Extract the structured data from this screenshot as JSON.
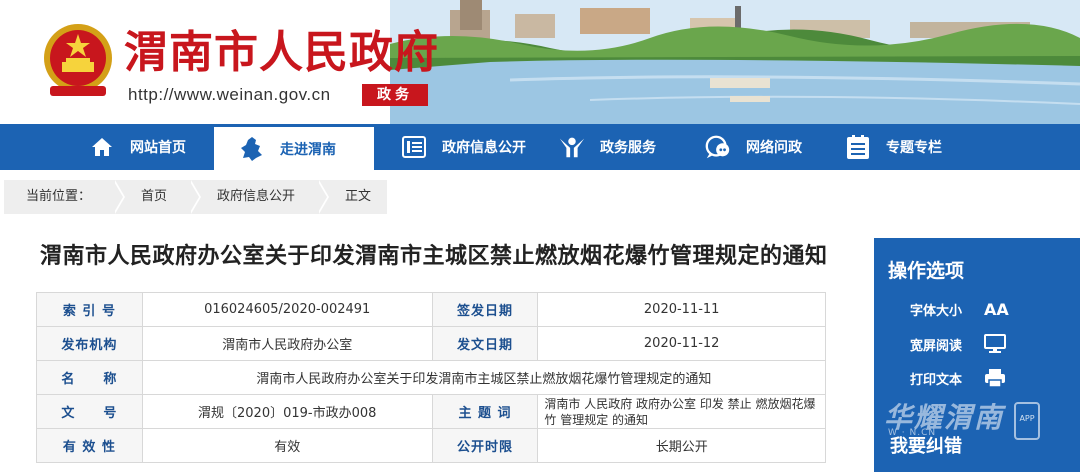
{
  "header": {
    "site_title": "渭南市人民政府",
    "site_url": "http://www.weinan.gov.cn",
    "badge": "政务",
    "emblem_icon": "national-emblem-icon",
    "colors": {
      "brand_red": "#c8161d",
      "nav_blue": "#1c63b3"
    }
  },
  "nav": {
    "items": [
      {
        "label": "网站首页",
        "icon": "home-icon"
      },
      {
        "label": "走进渭南",
        "icon": "region-map-icon"
      },
      {
        "label": "政府信息公开",
        "icon": "document-icon"
      },
      {
        "label": "政务服务",
        "icon": "service-person-icon"
      },
      {
        "label": "网络问政",
        "icon": "chat-bubble-icon"
      },
      {
        "label": "专题专栏",
        "icon": "list-clipboard-icon"
      }
    ],
    "active_index": 1
  },
  "breadcrumb": {
    "label": "当前位置：",
    "items": [
      "首页",
      "政府信息公开",
      "正文"
    ]
  },
  "article": {
    "title": "渭南市人民政府办公室关于印发渭南市主城区禁止燃放烟花爆竹管理规定的通知"
  },
  "meta": {
    "index_label": "索 引 号",
    "index_value": "016024605/2020-002491",
    "sign_date_label": "签发日期",
    "sign_date_value": "2020-11-11",
    "publisher_label": "发布机构",
    "publisher_value": "渭南市人民政府办公室",
    "issue_date_label": "发文日期",
    "issue_date_value": "2020-11-12",
    "name_label": "名　　称",
    "name_value": "渭南市人民政府办公室关于印发渭南市主城区禁止燃放烟花爆竹管理规定的通知",
    "docno_label": "文　　号",
    "docno_value": "渭规〔2020〕019-市政办008",
    "subject_label": "主 题 词",
    "subject_value": "渭南市 人民政府 政府办公室 印发 禁止 燃放烟花爆竹 管理规定 的通知",
    "validity_label": "有 效 性",
    "validity_value": "有效",
    "open_label": "公开时限",
    "open_value": "长期公开"
  },
  "side_panel": {
    "title": "操作选项",
    "font_size_label": "字体大小",
    "font_size_glyph": "AA",
    "wide_label": "宽屏阅读",
    "print_label": "打印文本",
    "watermark": "华耀渭南",
    "watermark_url": "W · N.CN",
    "app_badge": "APP",
    "feedback": "我要纠错"
  }
}
